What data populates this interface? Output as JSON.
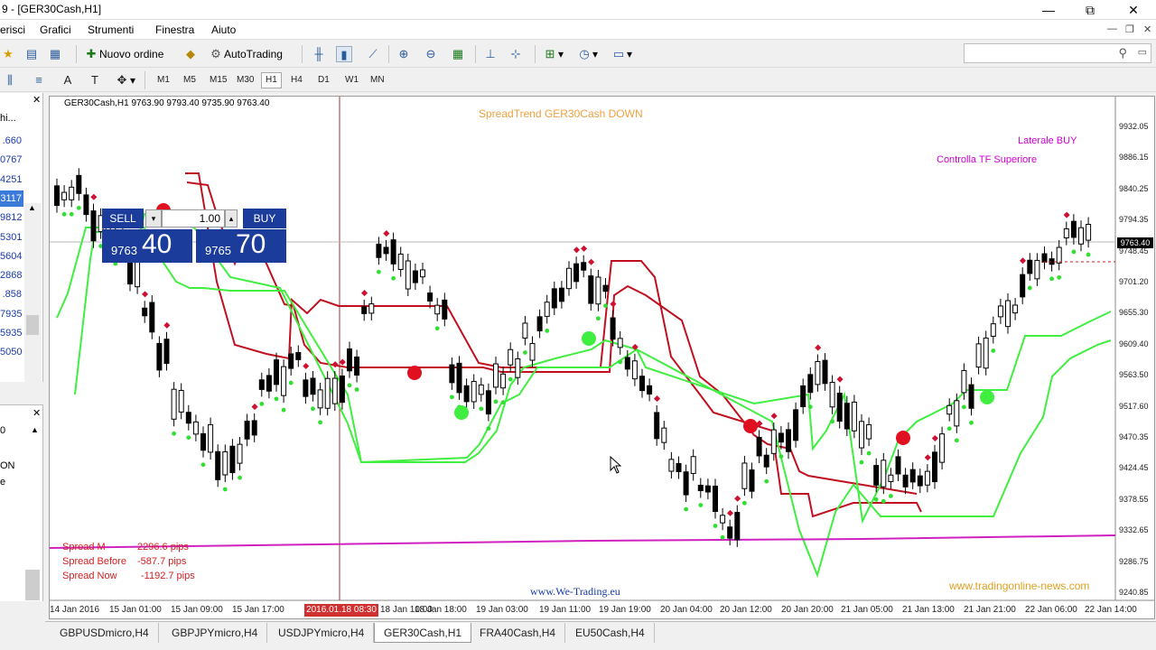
{
  "window": {
    "title": "9 - [GER30Cash,H1]",
    "min": "—",
    "max": "⧉",
    "close": "✕"
  },
  "menu": [
    "erisci",
    "Grafici",
    "Strumenti",
    "Finestra",
    "Aiuto"
  ],
  "toolbar": {
    "new_order": "Nuovo ordine",
    "autotrading": "AutoTrading"
  },
  "timeframes": [
    "M1",
    "M5",
    "M15",
    "M30",
    "H1",
    "H4",
    "D1",
    "W1",
    "MN"
  ],
  "active_timeframe": "H1",
  "market_watch": {
    "header": "hi...",
    "values": [
      ".660",
      "0767",
      "4251",
      "3117",
      "9812",
      "5301",
      "5604",
      "2868",
      ".858",
      "7935",
      "5935",
      "5050"
    ]
  },
  "navigator": {
    "items": [
      "0",
      "ON",
      "e"
    ]
  },
  "chart": {
    "header": "GER30Cash,H1  9763.90 9793.40 9735.90 9763.40",
    "spreadtrend": "SpreadTrend  GER30Cash  DOWN",
    "laterale": "Laterale BUY",
    "controlla": "Controlla TF Superiore",
    "watermark1": "www.We-Trading.eu",
    "watermark2": "www.tradingonline-news.com",
    "crosshair_time": "2016.01.18 08:30",
    "current_price": "9763.40",
    "spread": [
      {
        "label": "Spread M",
        "value": "2296.6 pips"
      },
      {
        "label": "Spread Before",
        "value": "-587.7 pips"
      },
      {
        "label": "Spread Now",
        "value": "-1192.7 pips"
      }
    ],
    "one_click": {
      "sell": "SELL",
      "buy": "BUY",
      "lot": "1.00",
      "sell_small": "9763",
      "sell_big": "40",
      "buy_small": "9765",
      "buy_big": "70"
    },
    "y_ticks": [
      "9932.05",
      "9886.15",
      "9840.25",
      "9794.35",
      "9748.45",
      "9701.20",
      "9655.30",
      "9609.40",
      "9563.50",
      "9517.60",
      "9470.35",
      "9424.45",
      "9378.55",
      "9332.65",
      "9286.75",
      "9240.85"
    ],
    "x_ticks": [
      "14 Jan 2016",
      "15 Jan 01:00",
      "15 Jan 09:00",
      "15 Jan 17:00",
      "18 Jan 10:00",
      "18 Jan 18:00",
      "19 Jan 03:00",
      "19 Jan 11:00",
      "19 Jan 19:00",
      "20 Jan 04:00",
      "20 Jan 12:00",
      "20 Jan 20:00",
      "21 Jan 05:00",
      "21 Jan 13:00",
      "21 Jan 21:00",
      "22 Jan 06:00",
      "22 Jan 14:00"
    ]
  },
  "tabs": [
    "GBPUSDmicro,H4",
    "GBPJPYmicro,H4",
    "USDJPYmicro,H4",
    "GER30Cash,H1",
    "FRA40Cash,H4",
    "EU50Cash,H4"
  ],
  "active_tab": "GER30Cash,H1"
}
